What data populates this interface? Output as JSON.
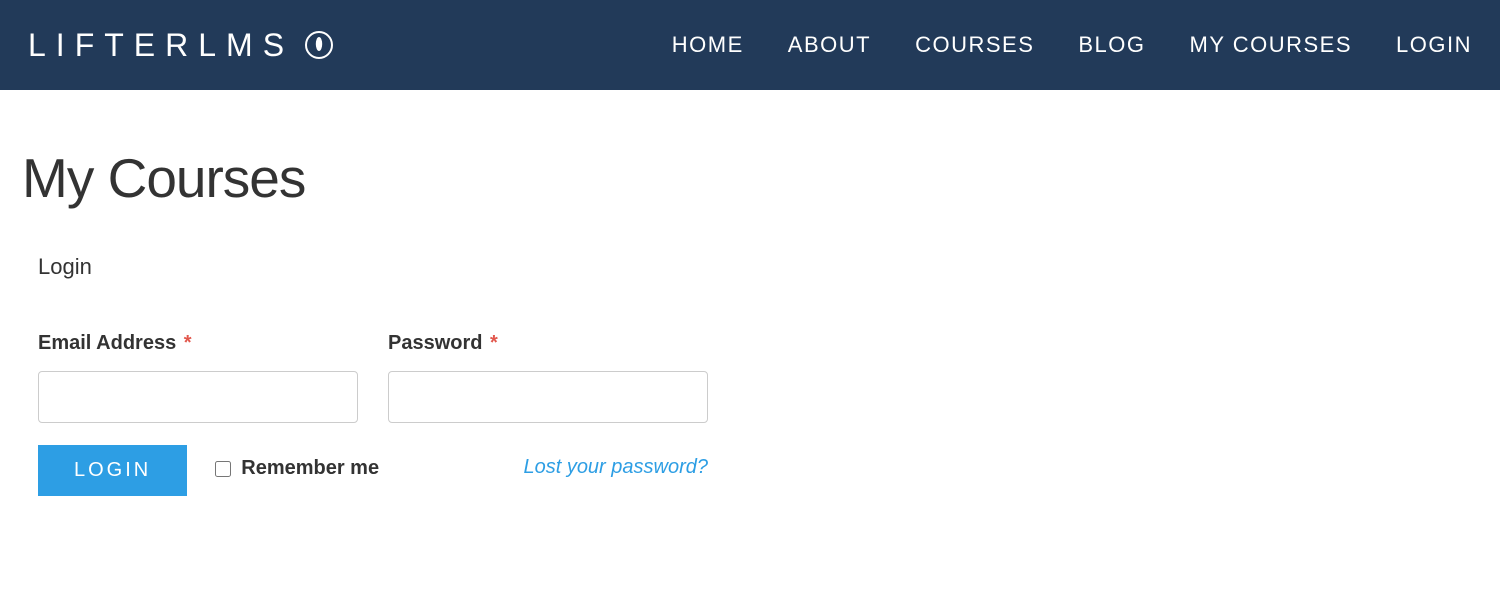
{
  "header": {
    "logo_text": "LIFTERLMS",
    "nav": [
      {
        "label": "HOME"
      },
      {
        "label": "ABOUT"
      },
      {
        "label": "COURSES"
      },
      {
        "label": "BLOG"
      },
      {
        "label": "MY COURSES"
      },
      {
        "label": "LOGIN"
      }
    ]
  },
  "main": {
    "page_title": "My Courses",
    "form_title": "Login",
    "email_label": "Email Address",
    "password_label": "Password",
    "required_mark": "*",
    "login_button": "LOGIN",
    "remember_label": "Remember me",
    "lost_password": "Lost your password?"
  }
}
